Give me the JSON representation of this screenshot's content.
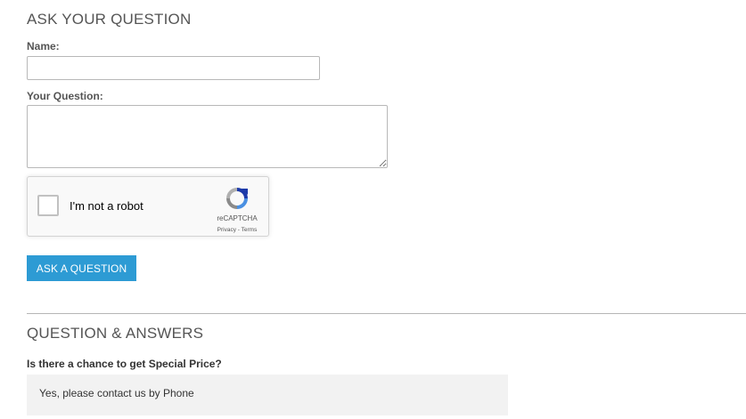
{
  "ask_form": {
    "title": "ASK YOUR QUESTION",
    "name_label": "Name:",
    "name_value": "",
    "question_label": "Your Question:",
    "question_value": "",
    "submit_label": "ASK A QUESTION"
  },
  "recaptcha": {
    "checkbox_label": "I'm not a robot",
    "checked": false,
    "brand": "reCAPTCHA",
    "privacy_link": "Privacy",
    "separator": " - ",
    "terms_link": "Terms",
    "logo_icon": "recaptcha-logo-icon"
  },
  "qa": {
    "title": "QUESTION & ANSWERS",
    "items": [
      {
        "question": "Is there a chance to get Special Price?",
        "answer": "Yes, please contact us by Phone"
      }
    ]
  },
  "colors": {
    "button_bg": "#2d9bd4",
    "button_text": "#ffffff",
    "answer_bg": "#f2f2f2",
    "divider": "#b5b5b5",
    "recaptcha_blue_dark": "#1c3aa9",
    "recaptcha_blue_light": "#4a90e2",
    "recaptcha_gray": "#b0b0b0"
  }
}
